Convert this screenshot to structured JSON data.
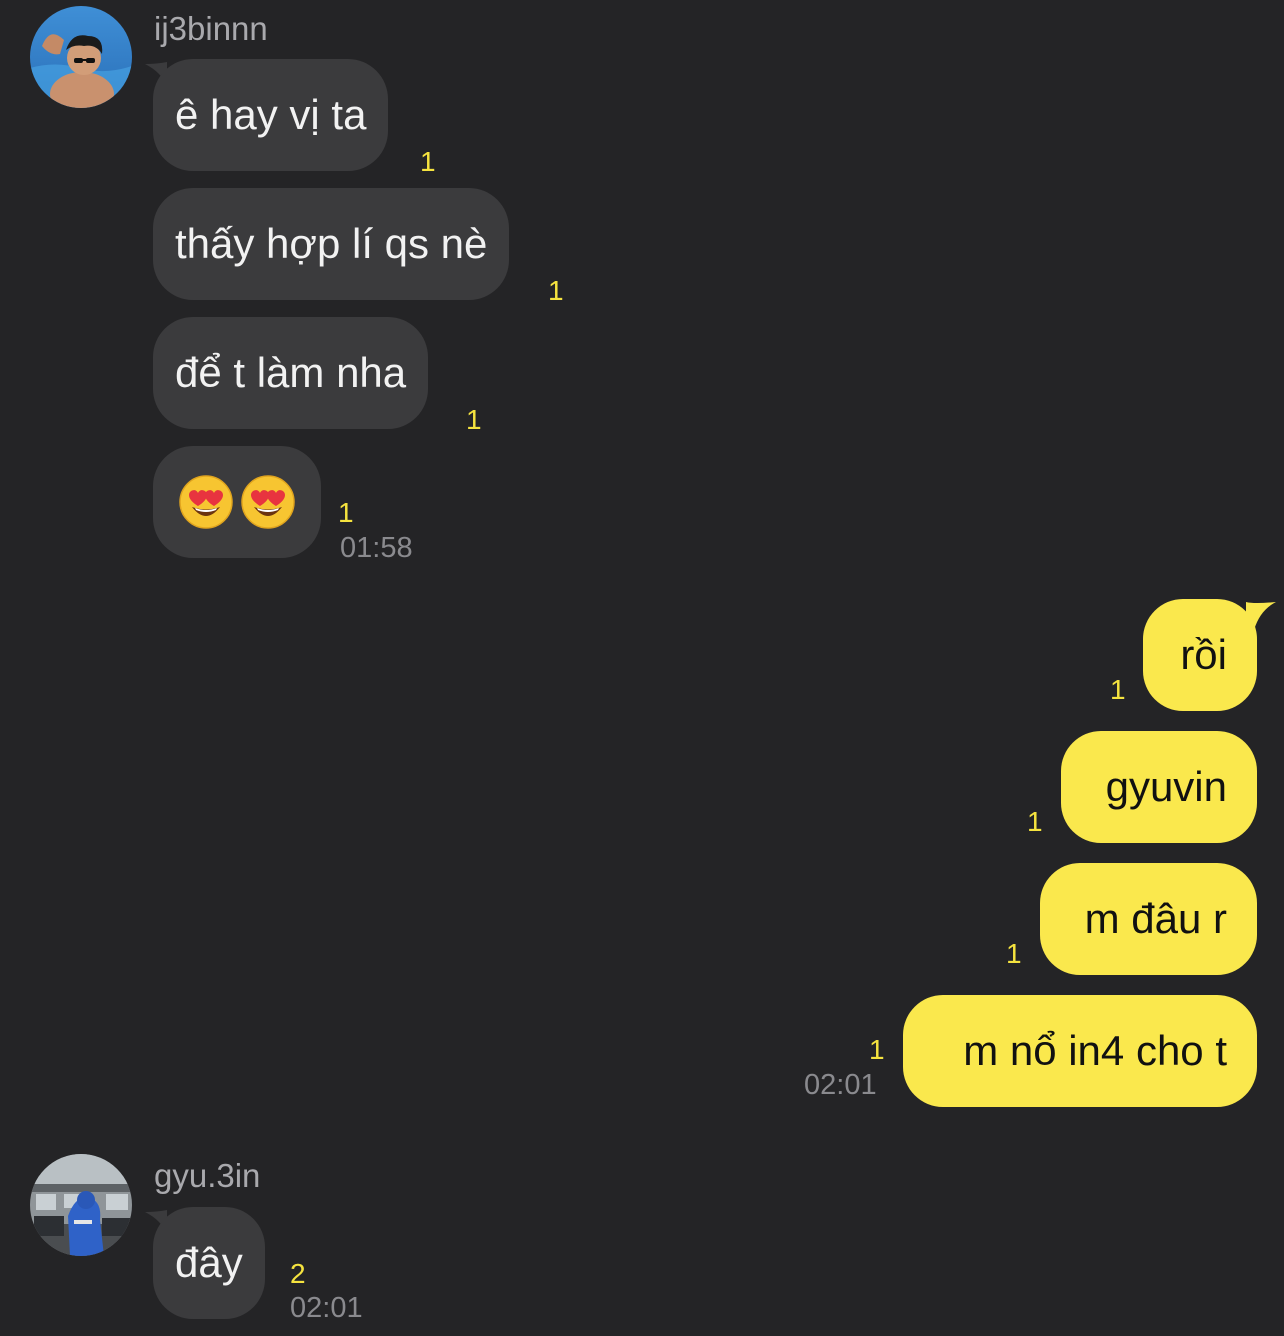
{
  "colors": {
    "background": "#242426",
    "incoming_bubble": "#3b3b3d",
    "outgoing_bubble": "#fae84d",
    "unread_count": "#f5e33f",
    "timestamp": "#8a8a8e",
    "sender_name": "#a9a9ad"
  },
  "group1": {
    "sender": "ij3binnn",
    "avatar": "profile-photo",
    "messages": [
      {
        "text": "ê hay vị ta",
        "count": "1"
      },
      {
        "text": "thấy hợp lí qs nè",
        "count": "1"
      },
      {
        "text": "để t làm nha",
        "count": "1"
      },
      {
        "emoji": [
          "smiling-face-with-heart-eyes",
          "smiling-face-with-heart-eyes"
        ],
        "count": "1"
      }
    ],
    "time": "01:58"
  },
  "group2": {
    "messages": [
      {
        "text": "rồi",
        "count": "1"
      },
      {
        "text": "gyuvin",
        "count": "1"
      },
      {
        "text": "m đâu r",
        "count": "1"
      },
      {
        "text": "m nổ in4 cho t",
        "count": "1"
      }
    ],
    "time": "02:01"
  },
  "group3": {
    "sender": "gyu.3in",
    "avatar": "profile-photo",
    "messages": [
      {
        "text": "đây",
        "count": "2"
      }
    ],
    "time": "02:01"
  }
}
